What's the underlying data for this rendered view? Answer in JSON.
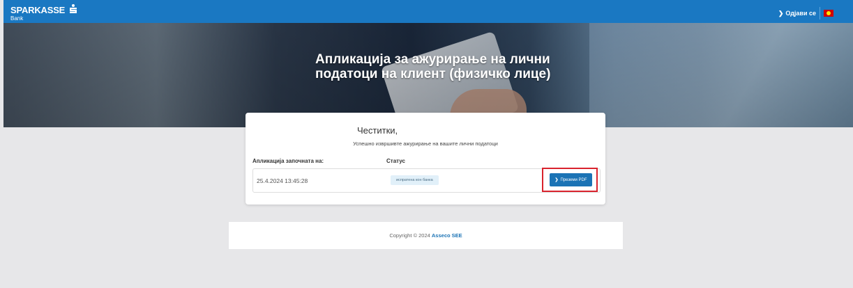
{
  "header": {
    "brand": "SPARKASSE",
    "brand_sub": "Bank",
    "logout_label": "Одјави се",
    "language": "mk-flag"
  },
  "hero": {
    "title_line1": "Апликација за ажурирање на лични",
    "title_line2": "податоци на клиент (физичко лице)"
  },
  "card": {
    "congrats": "Честитки,",
    "success_message": "Успешно извршивте ажурирање на вашите лични податоци",
    "col_started": "Апликација започната на:",
    "col_status": "Статус",
    "row": {
      "date": "25.4.2024 13:45:28",
      "status": "испратена кон банка",
      "action_label": "Преземи PDF"
    }
  },
  "footer": {
    "copyright": "Copyright © 2024",
    "company": "Asseco SEE"
  },
  "colors": {
    "topbar": "#1a78c2",
    "accent": "#1b73b5",
    "highlight": "#d9232d",
    "badge_bg": "#e1f0f9"
  }
}
